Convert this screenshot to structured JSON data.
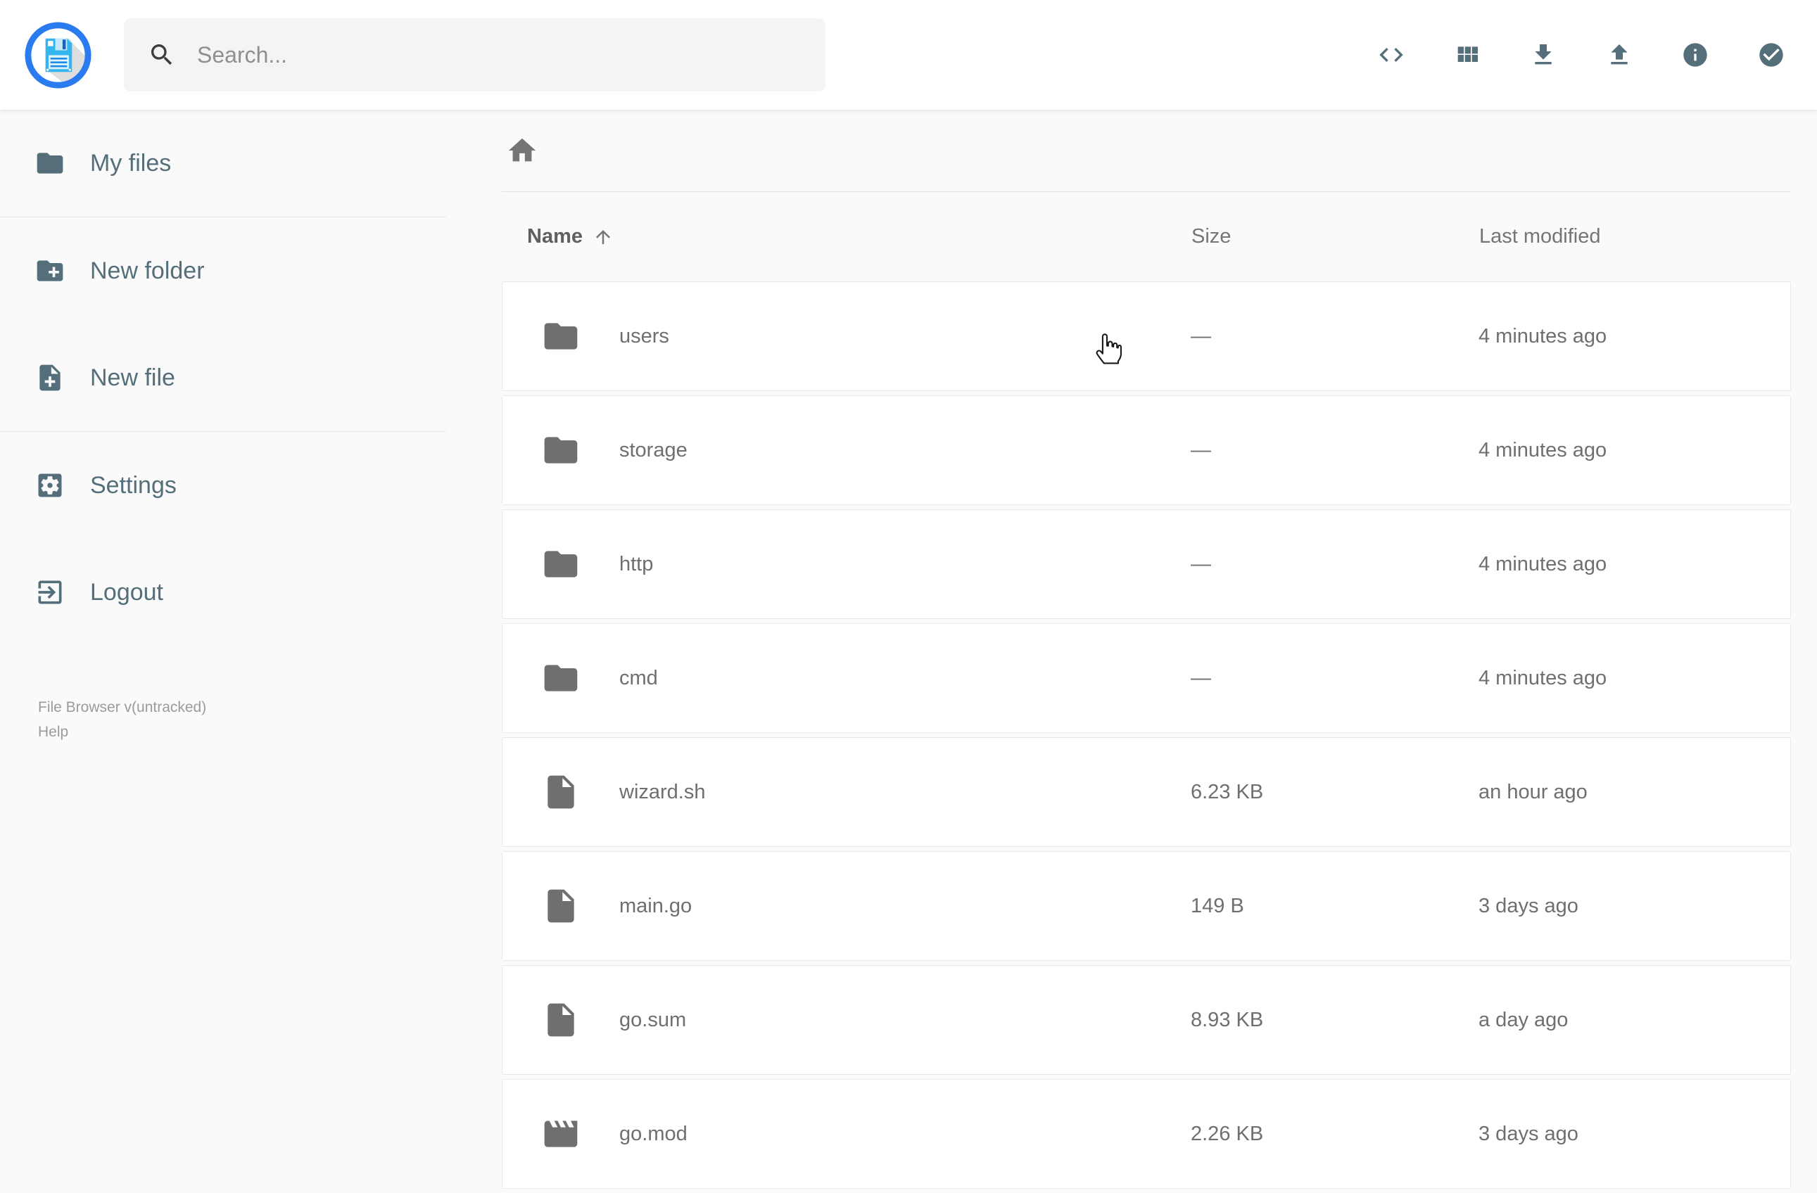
{
  "colors": {
    "accent_blue": "#2a7af0",
    "blue_grey": "#546e7a",
    "item_grey": "#6f6f6f",
    "page_bg": "#fafafa"
  },
  "header": {
    "search_placeholder": "Search...",
    "actions": [
      {
        "id": "raw-view",
        "icon": "code-icon"
      },
      {
        "id": "switch-view",
        "icon": "grid-icon"
      },
      {
        "id": "download",
        "icon": "download-icon"
      },
      {
        "id": "upload",
        "icon": "upload-icon"
      },
      {
        "id": "info",
        "icon": "info-icon"
      },
      {
        "id": "select-multiple",
        "icon": "check-circle-icon"
      }
    ]
  },
  "sidebar": {
    "items": [
      {
        "label": "My files",
        "icon": "folder-icon"
      },
      {
        "label": "New folder",
        "icon": "new-folder-icon"
      },
      {
        "label": "New file",
        "icon": "new-file-icon"
      },
      {
        "label": "Settings",
        "icon": "settings-icon"
      },
      {
        "label": "Logout",
        "icon": "logout-icon"
      }
    ],
    "footer": {
      "version": "File Browser v(untracked)",
      "help": "Help"
    }
  },
  "breadcrumb": {
    "root_icon": "home-icon"
  },
  "listing": {
    "columns": {
      "name": "Name",
      "size": "Size",
      "modified": "Last modified"
    },
    "sort": {
      "column": "name",
      "direction": "asc"
    },
    "items": [
      {
        "name": "users",
        "type": "folder",
        "size": "—",
        "modified": "4 minutes ago"
      },
      {
        "name": "storage",
        "type": "folder",
        "size": "—",
        "modified": "4 minutes ago"
      },
      {
        "name": "http",
        "type": "folder",
        "size": "—",
        "modified": "4 minutes ago"
      },
      {
        "name": "cmd",
        "type": "folder",
        "size": "—",
        "modified": "4 minutes ago"
      },
      {
        "name": "wizard.sh",
        "type": "file",
        "size": "6.23 KB",
        "modified": "an hour ago"
      },
      {
        "name": "main.go",
        "type": "file",
        "size": "149 B",
        "modified": "3 days ago"
      },
      {
        "name": "go.sum",
        "type": "file",
        "size": "8.93 KB",
        "modified": "a day ago"
      },
      {
        "name": "go.mod",
        "type": "movie",
        "size": "2.26 KB",
        "modified": "3 days ago"
      }
    ]
  }
}
